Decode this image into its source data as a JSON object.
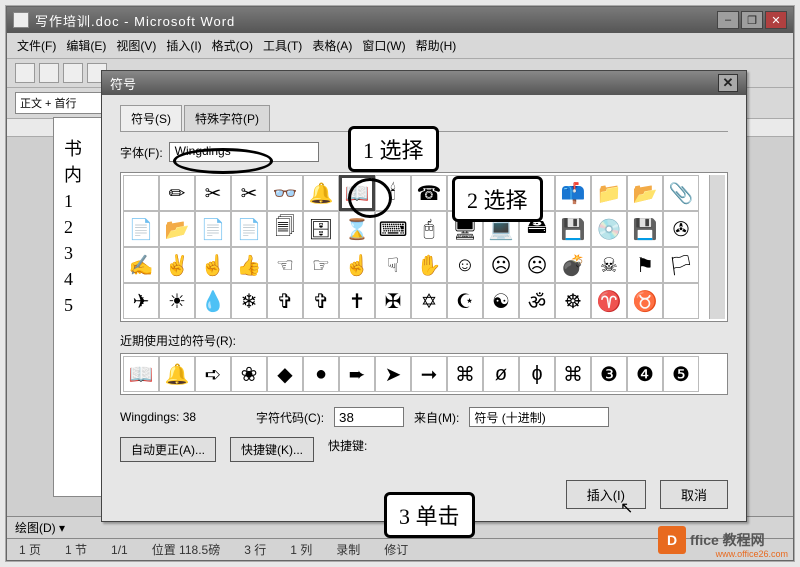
{
  "window": {
    "title": "写作培训.doc - Microsoft Word"
  },
  "menubar": {
    "file": "文件(F)",
    "edit": "编辑(E)",
    "view": "视图(V)",
    "insert": "插入(I)",
    "format": "格式(O)",
    "tools": "工具(T)",
    "table": "表格(A)",
    "window": "窗口(W)",
    "help": "帮助(H)"
  },
  "style_box": "正文 + 首行",
  "document_lines": {
    "l0": "书",
    "l1": "内",
    "l2": "1",
    "l3": "2",
    "l4": "3",
    "l5": "4",
    "l6": "5"
  },
  "draw_label": "绘图(D) ▾",
  "statusbar": {
    "page": "1 页",
    "sec": "1 节",
    "pos": "1/1",
    "at": "位置 118.5磅",
    "line": "3 行",
    "col": "1 列",
    "rec": "录制",
    "rev": "修订"
  },
  "dialog": {
    "title": "符号",
    "tab_symbols": "符号(S)",
    "tab_special": "特殊字符(P)",
    "font_label": "字体(F):",
    "font_value": "Wingdings",
    "recent_label": "近期使用过的符号(R):",
    "wingdings_code_label": "Wingdings: 38",
    "charcode_label": "字符代码(C):",
    "charcode_value": "38",
    "from_label": "来自(M):",
    "from_value": "符号 (十进制)",
    "autocorrect": "自动更正(A)...",
    "shortcut_btn": "快捷键(K)...",
    "shortcut_label": "快捷键:",
    "insert": "插入(I)",
    "cancel": "取消"
  },
  "symbols_grid": [
    " ",
    "✏",
    "✂",
    "✂",
    "👓",
    "🔔",
    "📖",
    "🕯",
    "☎",
    " ",
    " ",
    " ",
    "📫",
    "📁",
    "📂",
    "📎",
    "📄",
    "📂",
    "📄",
    "📄",
    "🗐",
    "🗄",
    "⌛",
    "⌨",
    "🖰",
    "🖥",
    "💻",
    "🖴",
    "💾",
    "💿",
    "💾",
    "✇",
    "✍",
    "✌",
    "☝",
    "👍",
    "☜",
    "☞",
    "☝",
    "☟",
    "✋",
    "☺",
    "☹",
    "☹",
    "💣",
    "☠",
    "⚑",
    "🏳",
    "✈",
    "☀",
    "💧",
    "❄",
    "✞",
    "✞",
    "✝",
    "✠",
    "✡",
    "☪",
    "☯",
    "ॐ",
    "☸",
    "♈",
    "♉",
    " "
  ],
  "recent_symbols": [
    "📖",
    "🔔",
    "➪",
    "❀",
    "◆",
    "●",
    "➨",
    "➤",
    "➞",
    "⌘",
    "ø",
    "ɸ",
    "⌘",
    "❸",
    "❹",
    "❺"
  ],
  "annotations": {
    "a1": "1 选择",
    "a2": "2 选择",
    "a3": "3 单击"
  },
  "logo": {
    "badge": "D",
    "text": "ffice 教程网",
    "url": "www.office26.com"
  }
}
